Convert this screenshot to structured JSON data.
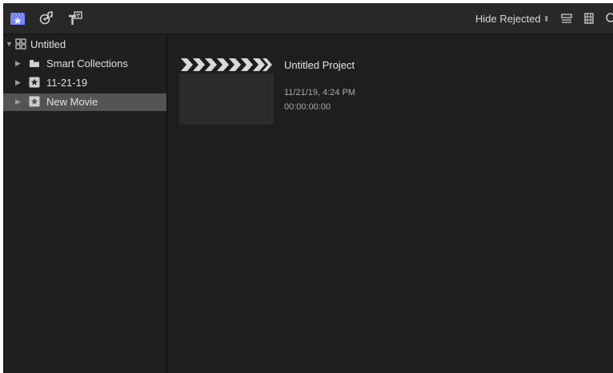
{
  "toolbar": {
    "icons": [
      "libraries-icon",
      "photos-audio-icon",
      "titles-generators-icon"
    ],
    "filter_label": "Hide Rejected",
    "filter_chevron": "⌃⌄",
    "right_icons": [
      "list-view-icon",
      "clip-appearance-icon",
      "search-icon"
    ]
  },
  "sidebar": {
    "items": [
      {
        "label": "Untitled",
        "icon": "library-icon",
        "expanded": true
      },
      {
        "label": "Smart Collections",
        "icon": "folder-icon",
        "expanded": false
      },
      {
        "label": "11-21-19",
        "icon": "event-star-icon",
        "expanded": false
      },
      {
        "label": "New Movie",
        "icon": "event-star-icon",
        "expanded": false,
        "selected": true
      }
    ]
  },
  "browser": {
    "project": {
      "title": "Untitled Project",
      "date": "11/21/19, 4:24 PM",
      "duration": "00:00:00:00"
    }
  },
  "colors": {
    "background": "#1e1e1e",
    "toolbar": "#282828",
    "selection": "#545454",
    "accent": "#6a7dff"
  }
}
